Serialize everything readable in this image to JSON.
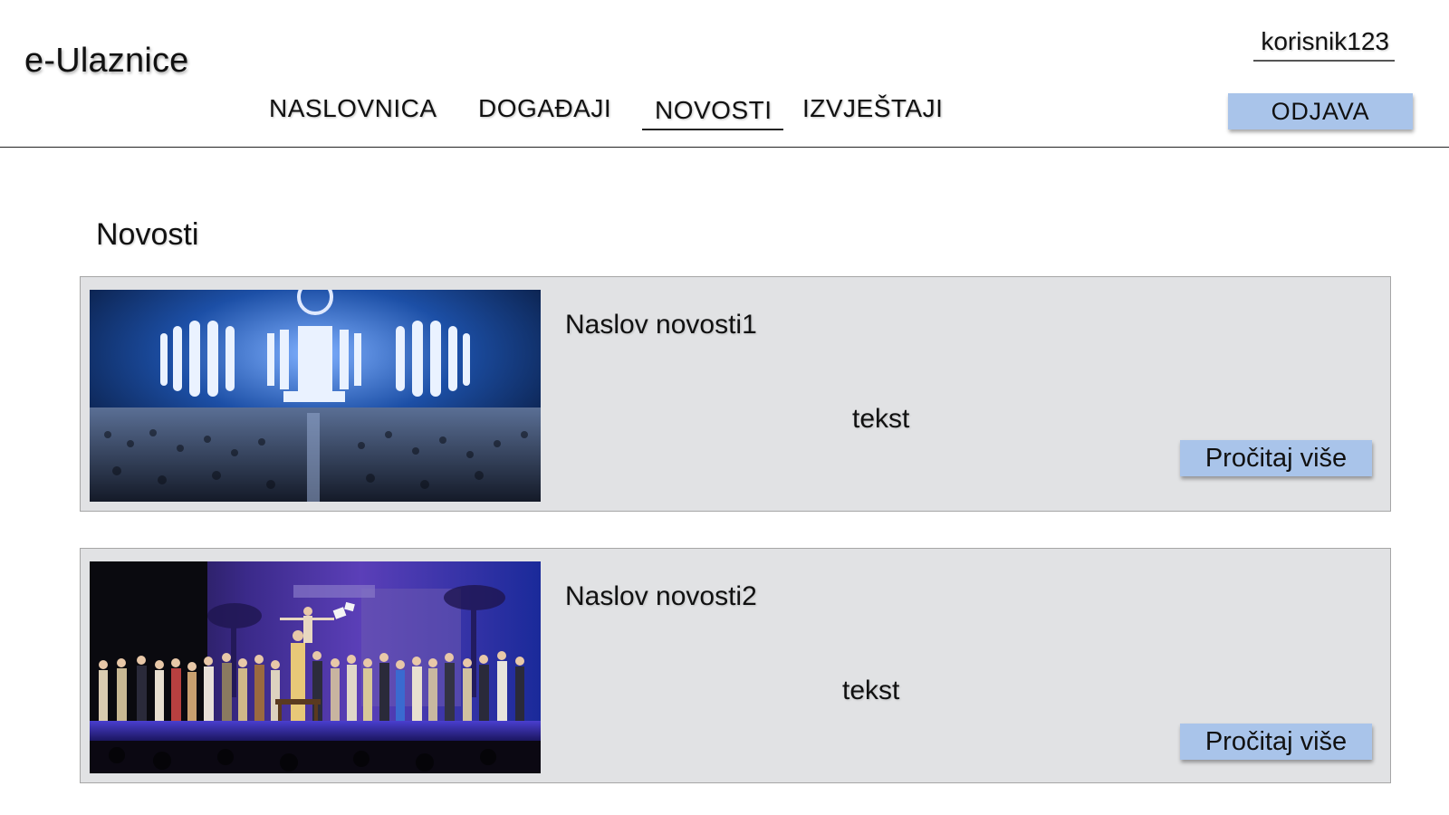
{
  "app": {
    "logo": "e-Ulaznice"
  },
  "nav": {
    "items": [
      {
        "label": "NASLOVNICA"
      },
      {
        "label": "DOGAĐAJI"
      },
      {
        "label": "NOVOSTI"
      },
      {
        "label": "IZVJEŠTAJI"
      }
    ],
    "active": "NOVOSTI"
  },
  "user": {
    "username": "korisnik123",
    "logout_label": "ODJAVA"
  },
  "main": {
    "title": "Novosti",
    "news": [
      {
        "title": "Naslov novosti1",
        "text": "tekst",
        "button_label": "Pročitaj više",
        "image": "concert-stage-photo"
      },
      {
        "title": "Naslov novosti2",
        "text": "tekst",
        "button_label": "Pročitaj više",
        "image": "theatre-stage-photo"
      }
    ]
  },
  "colors": {
    "button_bg": "#a9c4ea",
    "card_bg": "#e1e2e4",
    "card_border": "#a6a6a6"
  }
}
